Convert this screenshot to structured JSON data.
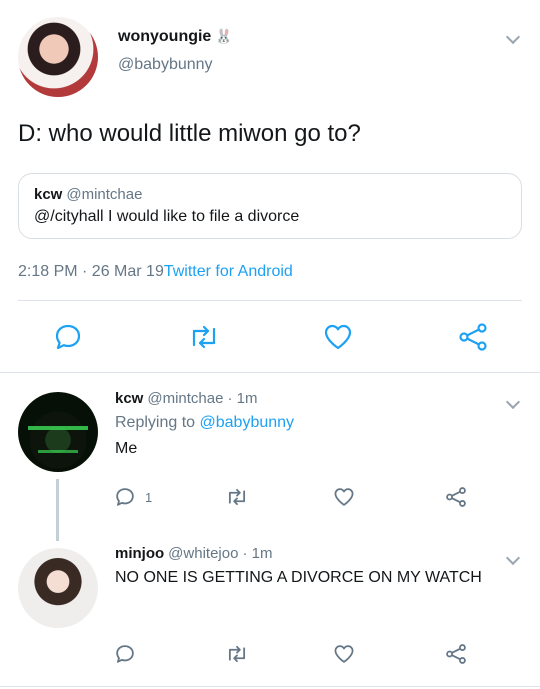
{
  "main_tweet": {
    "display_name": "wonyoungie",
    "name_emoji": "🐰",
    "handle": "@babybunny",
    "text": "D: who would little miwon go to?",
    "quote": {
      "display_name": "kcw",
      "handle": "@mintchae",
      "text": "@/cityhall I would like to file a divorce"
    },
    "time": "2:18 PM · 26 Mar 19",
    "source": "Twitter for Android",
    "actions": [
      "reply-icon",
      "retweet-icon",
      "like-icon",
      "share-icon"
    ]
  },
  "replies": [
    {
      "display_name": "kcw",
      "handle": "@mintchae",
      "age": "· 1m",
      "replying_prefix": "Replying to",
      "replying_handle": "@babybunny",
      "text": "Me",
      "reply_count": "1"
    },
    {
      "display_name": "minjoo",
      "handle": "@whitejoo",
      "age": "· 1m",
      "text": "NO ONE IS GETTING A DIVORCE ON MY WATCH"
    }
  ],
  "colors": {
    "link": "#1da1f2",
    "muted": "#657786",
    "text": "#14171a",
    "divider": "#dde3e8"
  }
}
